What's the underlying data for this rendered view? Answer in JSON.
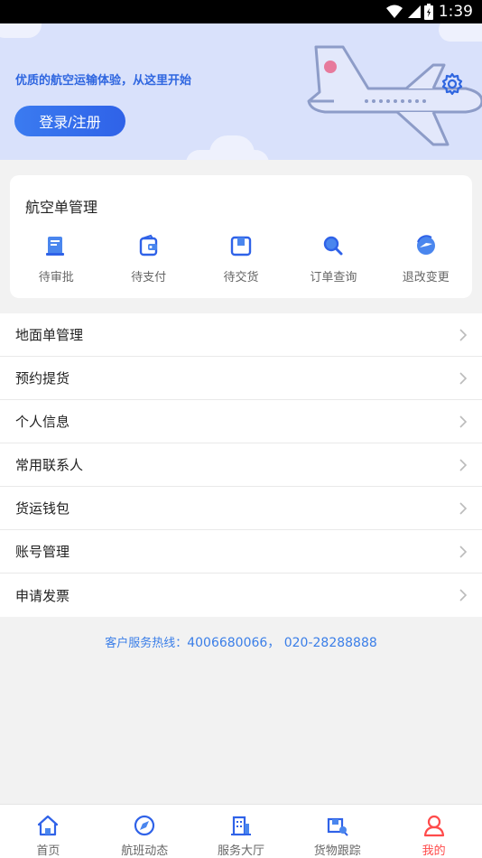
{
  "status_bar": {
    "time": "1:39"
  },
  "banner": {
    "tagline": "优质的航空运输体验，从这里开始",
    "login_label": "登录/注册"
  },
  "air_waybill": {
    "title": "航空单管理",
    "items": [
      {
        "label": "待审批",
        "icon": "approval-doc-icon"
      },
      {
        "label": "待支付",
        "icon": "wallet-icon"
      },
      {
        "label": "待交货",
        "icon": "package-icon"
      },
      {
        "label": "订单查询",
        "icon": "search-icon"
      },
      {
        "label": "退改变更",
        "icon": "refresh-plane-icon"
      }
    ]
  },
  "menu": {
    "items": [
      {
        "label": "地面单管理"
      },
      {
        "label": "预约提货"
      },
      {
        "label": "个人信息"
      },
      {
        "label": "常用联系人"
      },
      {
        "label": "货运钱包"
      },
      {
        "label": "账号管理"
      },
      {
        "label": "申请发票"
      }
    ]
  },
  "hotline": {
    "label": "客户服务热线：",
    "numbers": "4006680066，  020-28288888"
  },
  "tabbar": {
    "items": [
      {
        "label": "首页",
        "icon": "home-icon"
      },
      {
        "label": "航班动态",
        "icon": "flight-compass-icon"
      },
      {
        "label": "服务大厅",
        "icon": "building-icon"
      },
      {
        "label": "货物跟踪",
        "icon": "cargo-track-icon"
      },
      {
        "label": "我的",
        "icon": "user-icon",
        "active": true
      }
    ],
    "active_color": "#ff4b4b"
  },
  "colors": {
    "accent": "#3a7ee8",
    "banner_bg": "#d9e1fb"
  }
}
